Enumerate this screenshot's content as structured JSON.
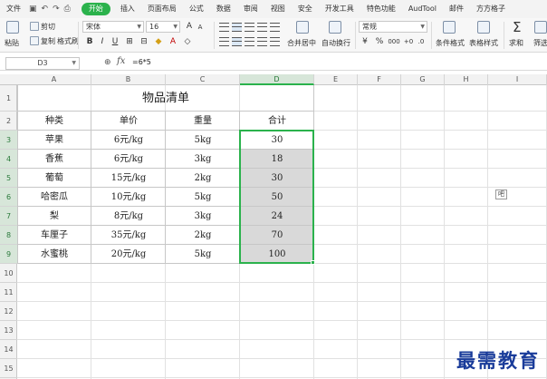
{
  "menubar": {
    "file_label": "文件",
    "tabs": [
      "开始",
      "插入",
      "页面布局",
      "公式",
      "数据",
      "审阅",
      "视图",
      "安全",
      "开发工具",
      "特色功能",
      "AudTool",
      "邮件",
      "方方格子"
    ],
    "active_tab": "开始"
  },
  "ribbon": {
    "paste_label": "粘贴",
    "cut_label": "剪切",
    "copy_label": "复制",
    "format_painter_label": "格式刷",
    "font_name": "宋体",
    "font_size": "16",
    "bold": "B",
    "italic": "I",
    "underline": "U",
    "merge_label": "合并居中",
    "wrap_label": "自动换行",
    "number_format": "常规",
    "percent": "%",
    "thousands": "000",
    "cond_format_label": "条件格式",
    "table_style_label": "表格样式",
    "sum_label": "求和",
    "filter_label": "筛选",
    "sigma": "Σ",
    "currency_symbol": "¥"
  },
  "formula_bar": {
    "cell_ref": "D3",
    "fx": "fx",
    "formula": "=6*5"
  },
  "columns": [
    "A",
    "B",
    "C",
    "D",
    "E",
    "F",
    "G",
    "H",
    "I"
  ],
  "selected_column": "D",
  "rows": [
    "1",
    "2",
    "3",
    "4",
    "5",
    "6",
    "7",
    "8",
    "9",
    "10",
    "11",
    "12",
    "13",
    "14",
    "15"
  ],
  "selected_rows": [
    "3",
    "4",
    "5",
    "6",
    "7",
    "8",
    "9"
  ],
  "sheet": {
    "title": "物品清单",
    "headers": [
      "种类",
      "单价",
      "重量",
      "合计"
    ],
    "data": [
      [
        "苹果",
        "6元/kg",
        "5kg",
        "30"
      ],
      [
        "香蕉",
        "6元/kg",
        "3kg",
        "18"
      ],
      [
        "葡萄",
        "15元/kg",
        "2kg",
        "30"
      ],
      [
        "哈密瓜",
        "10元/kg",
        "5kg",
        "50"
      ],
      [
        "梨",
        "8元/kg",
        "3kg",
        "24"
      ],
      [
        "车厘子",
        "35元/kg",
        "2kg",
        "70"
      ],
      [
        "水蜜桃",
        "20元/kg",
        "5kg",
        "100"
      ]
    ]
  },
  "quick_button_label": "吧",
  "watermark": "最需教育"
}
